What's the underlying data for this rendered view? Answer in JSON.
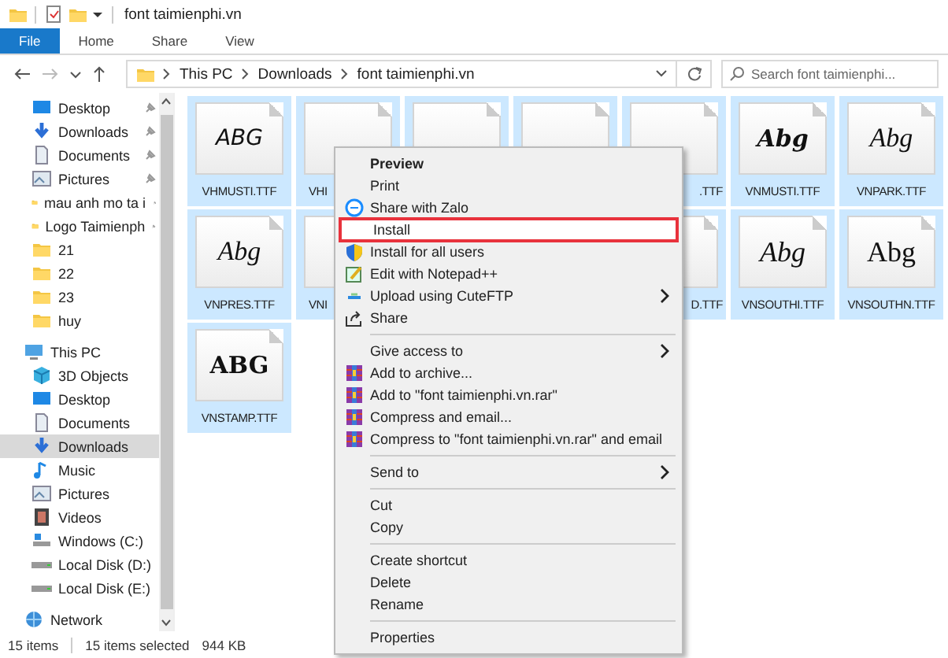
{
  "window": {
    "title": "font taimienphi.vn"
  },
  "ribbon_tabs": [
    {
      "label": "File",
      "selected": true
    },
    {
      "label": "Home",
      "selected": false
    },
    {
      "label": "Share",
      "selected": false
    },
    {
      "label": "View",
      "selected": false
    }
  ],
  "address_bar": {
    "path": [
      "This PC",
      "Downloads",
      "font taimienphi.vn"
    ]
  },
  "search": {
    "placeholder": "Search font taimienphi..."
  },
  "sidebar": {
    "quick_access": [
      {
        "label": "Desktop",
        "kind": "desktop",
        "pinned": true,
        "selected": false
      },
      {
        "label": "Downloads",
        "kind": "download",
        "pinned": true,
        "selected": false
      },
      {
        "label": "Documents",
        "kind": "document",
        "pinned": true,
        "selected": false
      },
      {
        "label": "Pictures",
        "kind": "picture",
        "pinned": true,
        "selected": false
      },
      {
        "label": "mau anh mo ta i",
        "kind": "folder",
        "pinned": true,
        "selected": false
      },
      {
        "label": "Logo Taimienph",
        "kind": "folder",
        "pinned": true,
        "selected": false
      },
      {
        "label": "21",
        "kind": "folder",
        "pinned": false,
        "selected": false
      },
      {
        "label": "22",
        "kind": "folder",
        "pinned": false,
        "selected": false
      },
      {
        "label": "23",
        "kind": "folder",
        "pinned": false,
        "selected": false
      },
      {
        "label": "huy",
        "kind": "folder",
        "pinned": false,
        "selected": false
      }
    ],
    "tree": [
      {
        "label": "This PC",
        "kind": "pc",
        "selected": false,
        "children": [
          {
            "label": "3D Objects",
            "kind": "cube",
            "selected": false
          },
          {
            "label": "Desktop",
            "kind": "desktop",
            "selected": false
          },
          {
            "label": "Documents",
            "kind": "document",
            "selected": false
          },
          {
            "label": "Downloads",
            "kind": "download",
            "selected": true
          },
          {
            "label": "Music",
            "kind": "music",
            "selected": false
          },
          {
            "label": "Pictures",
            "kind": "picture",
            "selected": false
          },
          {
            "label": "Videos",
            "kind": "video",
            "selected": false
          },
          {
            "label": "Windows (C:)",
            "kind": "windrive",
            "selected": false
          },
          {
            "label": "Local Disk (D:)",
            "kind": "drive",
            "selected": false
          },
          {
            "label": "Local Disk (E:)",
            "kind": "drive",
            "selected": false
          }
        ]
      },
      {
        "label": "Network",
        "kind": "network",
        "selected": false
      }
    ]
  },
  "files": [
    {
      "kind": "script",
      "label": "VHMUSTI.TTF",
      "preview": "ABG",
      "selected": true
    },
    {
      "kind": "covered",
      "label": "VHI",
      "selected": true
    },
    {
      "kind": "covered",
      "selected": true
    },
    {
      "kind": "covered",
      "selected": true
    },
    {
      "kind": "covered",
      "label": ".TTF",
      "selected": true
    },
    {
      "kind": "brush",
      "label": "VNMUSTI.TTF",
      "preview": "Abg",
      "selected": true
    },
    {
      "kind": "fancy",
      "label": "VNPARK.TTF",
      "preview": "Abg",
      "selected": true
    },
    {
      "kind": "fancy",
      "label": "VNPRES.TTF",
      "preview": "Abg",
      "selected": true
    },
    {
      "kind": "covered",
      "label": "VNI",
      "selected": true
    },
    {
      "kind": "hidden"
    },
    {
      "kind": "hidden"
    },
    {
      "kind": "covered",
      "label": "D.TTF",
      "selected": true
    },
    {
      "kind": "italic",
      "label": "VNSOUTHI.TTF",
      "preview": "Abg",
      "selected": true
    },
    {
      "kind": "serif",
      "label": "VNSOUTHN.TTF",
      "preview": "Abg",
      "selected": true
    },
    {
      "kind": "stamp",
      "label": "VNSTAMP.TTF",
      "preview": "ABG",
      "selected": true
    }
  ],
  "context_menu": [
    {
      "kind": "item",
      "label": "Preview",
      "default": true
    },
    {
      "kind": "item",
      "label": "Print"
    },
    {
      "kind": "item",
      "label": "Share with Zalo"
    },
    {
      "kind": "item",
      "label": "Install",
      "highlighted": true
    },
    {
      "kind": "item",
      "label": "Install for all users"
    },
    {
      "kind": "item",
      "label": "Edit with Notepad++"
    },
    {
      "kind": "item",
      "label": "Upload using CuteFTP",
      "submenu": true
    },
    {
      "kind": "item",
      "label": "Share"
    },
    {
      "kind": "separator"
    },
    {
      "kind": "item",
      "label": "Give access to",
      "submenu": true
    },
    {
      "kind": "item",
      "label": "Add to archive..."
    },
    {
      "kind": "item",
      "label": "Add to \"font taimienphi.vn.rar\""
    },
    {
      "kind": "item",
      "label": "Compress and email..."
    },
    {
      "kind": "item",
      "label": "Compress to \"font taimienphi.vn.rar\" and email"
    },
    {
      "kind": "separator"
    },
    {
      "kind": "item",
      "label": "Send to",
      "submenu": true
    },
    {
      "kind": "separator"
    },
    {
      "kind": "item",
      "label": "Cut"
    },
    {
      "kind": "item",
      "label": "Copy"
    },
    {
      "kind": "separator"
    },
    {
      "kind": "item",
      "label": "Create shortcut"
    },
    {
      "kind": "item",
      "label": "Delete"
    },
    {
      "kind": "item",
      "label": "Rename"
    },
    {
      "kind": "separator"
    },
    {
      "kind": "item",
      "label": "Properties"
    }
  ],
  "status_bar": {
    "count": "15 items",
    "selection": "15 items selected",
    "size": "944 KB"
  }
}
